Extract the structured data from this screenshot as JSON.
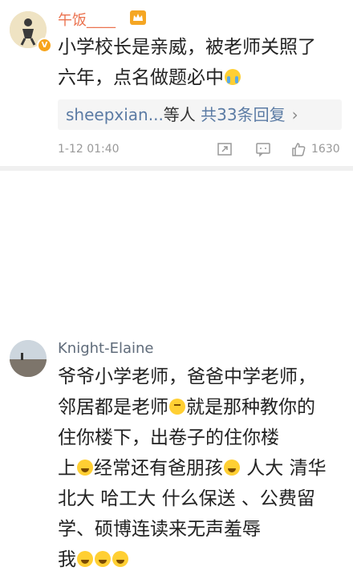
{
  "comments": [
    {
      "user": "午饭____",
      "text_line1": "小学校长是亲威，被老师关照了",
      "text_line2": "六年，点名做题必中",
      "replies": {
        "user": "sheepxian...",
        "mid": "等人",
        "count": "共33条回复",
        "arrow": "›"
      },
      "time": "1-12 01:40",
      "likes": "1630"
    },
    {
      "user": "Knight-Elaine",
      "line1": "爷爷小学老师，爸爸中学老师，",
      "line2a": "邻居都是老师",
      "line2b": "就是那种教你的",
      "line3": "住你楼下，出卷子的住你楼",
      "line4a": "上",
      "line4b": "经常还有爸朋孩",
      "line4c": " 人大 清华",
      "line5": "北大 哈工大 什么保送 、公费留",
      "line6": "学、硕博连读来无声羞辱",
      "line7": "我"
    }
  ],
  "icons": {
    "vip": "vip-badge-icon",
    "crown": "crown-icon",
    "repost": "repost-icon",
    "reply": "reply-icon",
    "like": "like-icon"
  },
  "colors": {
    "vip_name": "#eb7350",
    "link": "#5b7ba4"
  }
}
